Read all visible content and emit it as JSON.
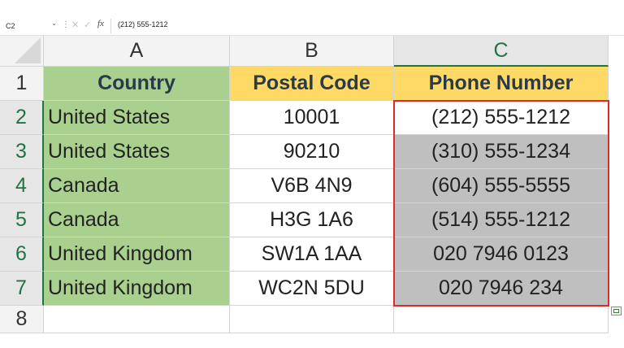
{
  "formula_bar": {
    "name_box": "C2",
    "fx_label": "fx",
    "content": "(212) 555-1212"
  },
  "columns": [
    "A",
    "B",
    "C"
  ],
  "rows": [
    "1",
    "2",
    "3",
    "4",
    "5",
    "6",
    "7",
    "8"
  ],
  "table": {
    "headers": [
      "Country",
      "Postal Code",
      "Phone Number"
    ],
    "data": [
      [
        "United States",
        "10001",
        "(212) 555-1212"
      ],
      [
        "United States",
        "90210",
        "(310) 555-1234"
      ],
      [
        "Canada",
        "V6B 4N9",
        "(604) 555-5555"
      ],
      [
        "Canada",
        "H3G 1A6",
        "(514) 555-1212"
      ],
      [
        "United Kingdom",
        "SW1A 1AA",
        "020 7946 0123"
      ],
      [
        "United Kingdom",
        "WC2N 5DU",
        "020 7946 234"
      ]
    ]
  },
  "colors": {
    "country_fill": "#a9d08e",
    "postal_header_fill": "#ffd966",
    "phone_header_fill": "#ffd966",
    "phone_rows_fill": "#bfbfbf",
    "active_cell_fill": "#ffffff",
    "selection_border": "#e02a2a",
    "excel_green": "#217346"
  },
  "selection": {
    "active_cell": "C2",
    "range": "C2:C7"
  }
}
